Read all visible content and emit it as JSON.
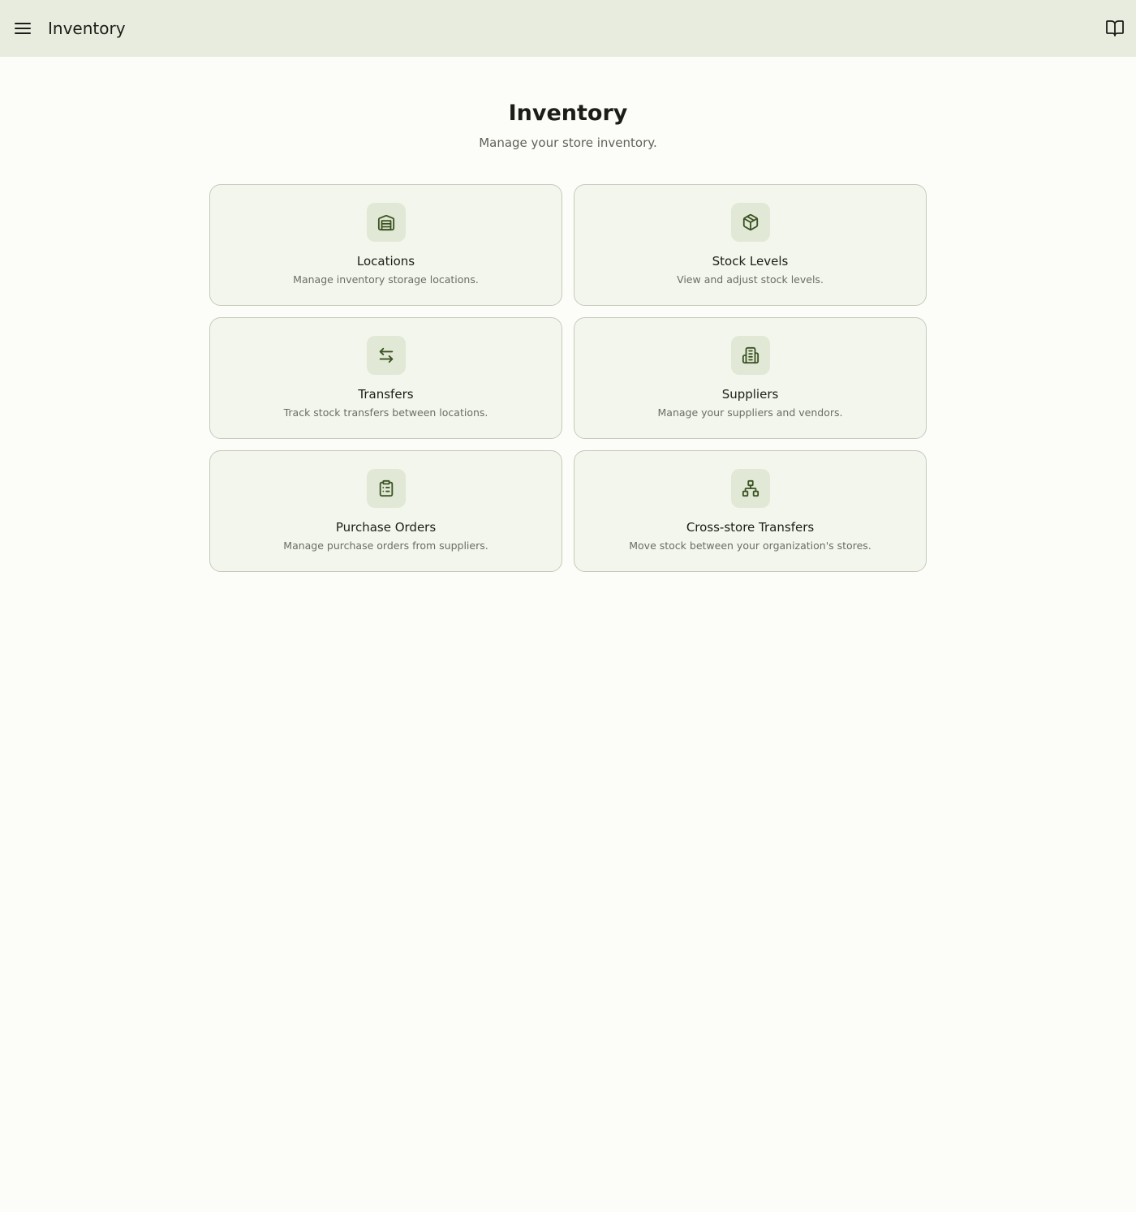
{
  "app_bar": {
    "title": "Inventory",
    "menu_icon": "menu-icon",
    "right_icon": "book-icon"
  },
  "header": {
    "title": "Inventory",
    "subtitle": "Manage your store inventory."
  },
  "cards": [
    {
      "title": "Locations",
      "description": "Manage inventory storage locations.",
      "icon": "warehouse-icon"
    },
    {
      "title": "Stock Levels",
      "description": "View and adjust stock levels.",
      "icon": "package-icon"
    },
    {
      "title": "Transfers",
      "description": "Track stock transfers between locations.",
      "icon": "arrows-left-right-icon"
    },
    {
      "title": "Suppliers",
      "description": "Manage your suppliers and vendors.",
      "icon": "building-icon"
    },
    {
      "title": "Purchase Orders",
      "description": "Manage purchase orders from suppliers.",
      "icon": "clipboard-list-icon"
    },
    {
      "title": "Cross-store Transfers",
      "description": "Move stock between your organization's stores.",
      "icon": "network-icon"
    }
  ],
  "colors": {
    "app_bar_bg": "#e7ecde",
    "page_bg": "#fcfdf8",
    "card_bg": "#f3f6ec",
    "card_border": "#c6cabb",
    "icon_tile_bg": "#e2e8d6",
    "icon_color": "#3b5322"
  }
}
